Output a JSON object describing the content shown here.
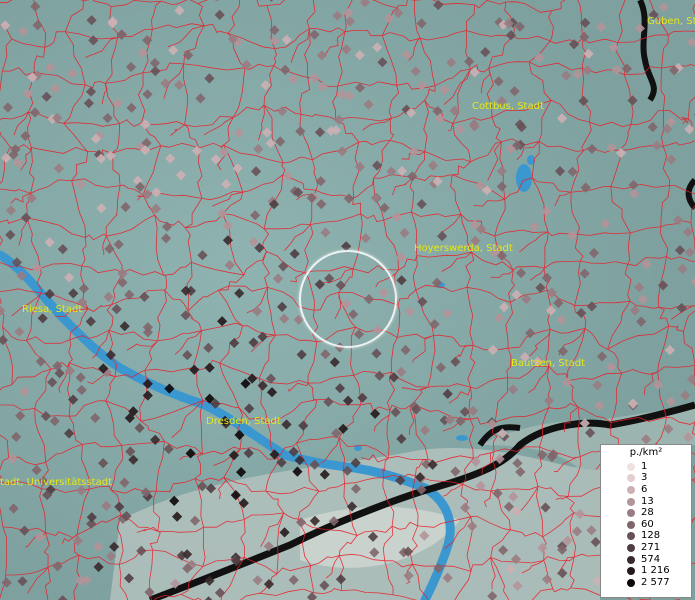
{
  "map": {
    "cities": [
      {
        "name": "Guben, St"
      },
      {
        "name": "Cottbus, Stadt"
      },
      {
        "name": "Hoyerswerda, Stadt"
      },
      {
        "name": "Riesa, Stadt"
      },
      {
        "name": "Bautzen, Stadt"
      },
      {
        "name": "Dresden, Stadt"
      },
      {
        "name": "tadt, Universitätsstadt"
      }
    ],
    "colors": {
      "terrain": "#8fb0ae",
      "water": "#3a97cf",
      "borders": "#e8202a",
      "national_border": "#111111",
      "label": "#e6e619"
    }
  },
  "legend": {
    "title": "p./km²",
    "entries": [
      {
        "label": "1",
        "color": "#f1e2e2"
      },
      {
        "label": "3",
        "color": "#e3cfd0"
      },
      {
        "label": "6",
        "color": "#ccb0b4"
      },
      {
        "label": "13",
        "color": "#b39499"
      },
      {
        "label": "28",
        "color": "#997c82"
      },
      {
        "label": "60",
        "color": "#80666b"
      },
      {
        "label": "128",
        "color": "#675156"
      },
      {
        "label": "271",
        "color": "#4f3d42"
      },
      {
        "label": "574",
        "color": "#392a2e"
      },
      {
        "label": "1 216",
        "color": "#24181b"
      },
      {
        "label": "2 577",
        "color": "#0d0608"
      }
    ]
  }
}
